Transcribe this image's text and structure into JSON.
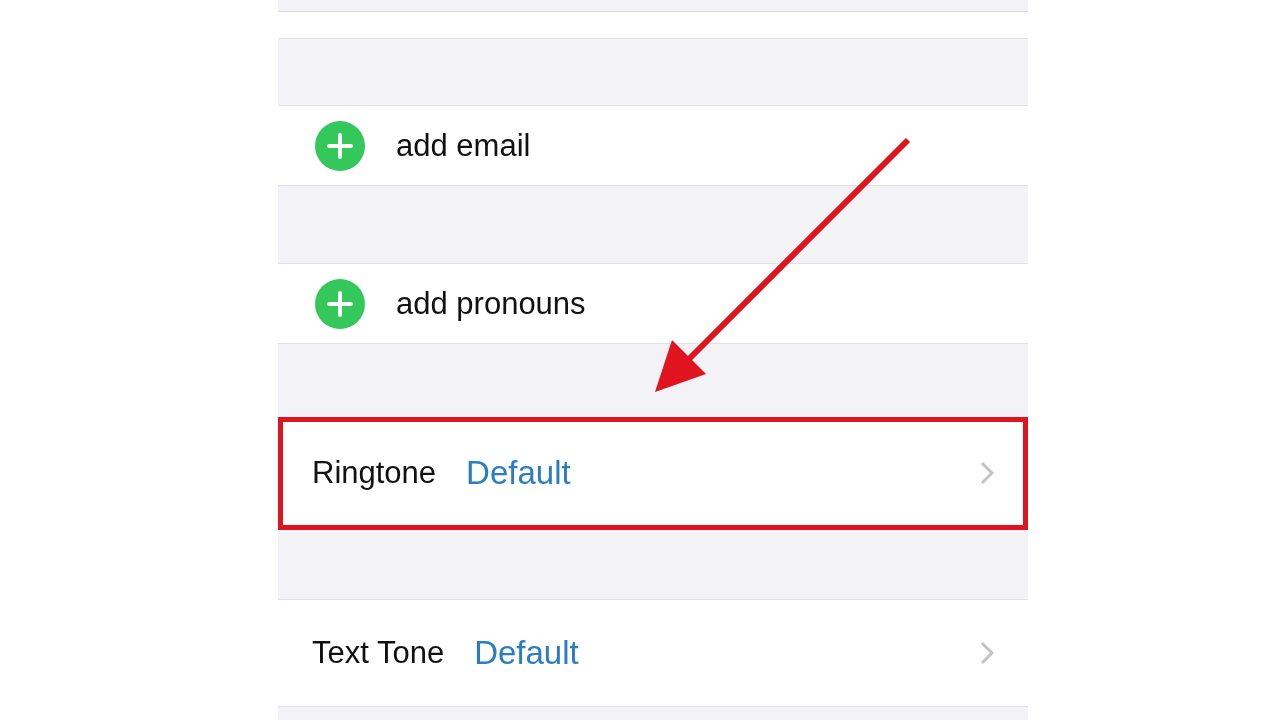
{
  "rows": [
    {
      "kind": "add",
      "label": "add email",
      "highlighted": false
    },
    {
      "kind": "add",
      "label": "add pronouns",
      "highlighted": false
    },
    {
      "kind": "value",
      "label": "Ringtone",
      "value": "Default",
      "highlighted": true
    },
    {
      "kind": "value",
      "label": "Text Tone",
      "value": "Default",
      "highlighted": false
    }
  ]
}
